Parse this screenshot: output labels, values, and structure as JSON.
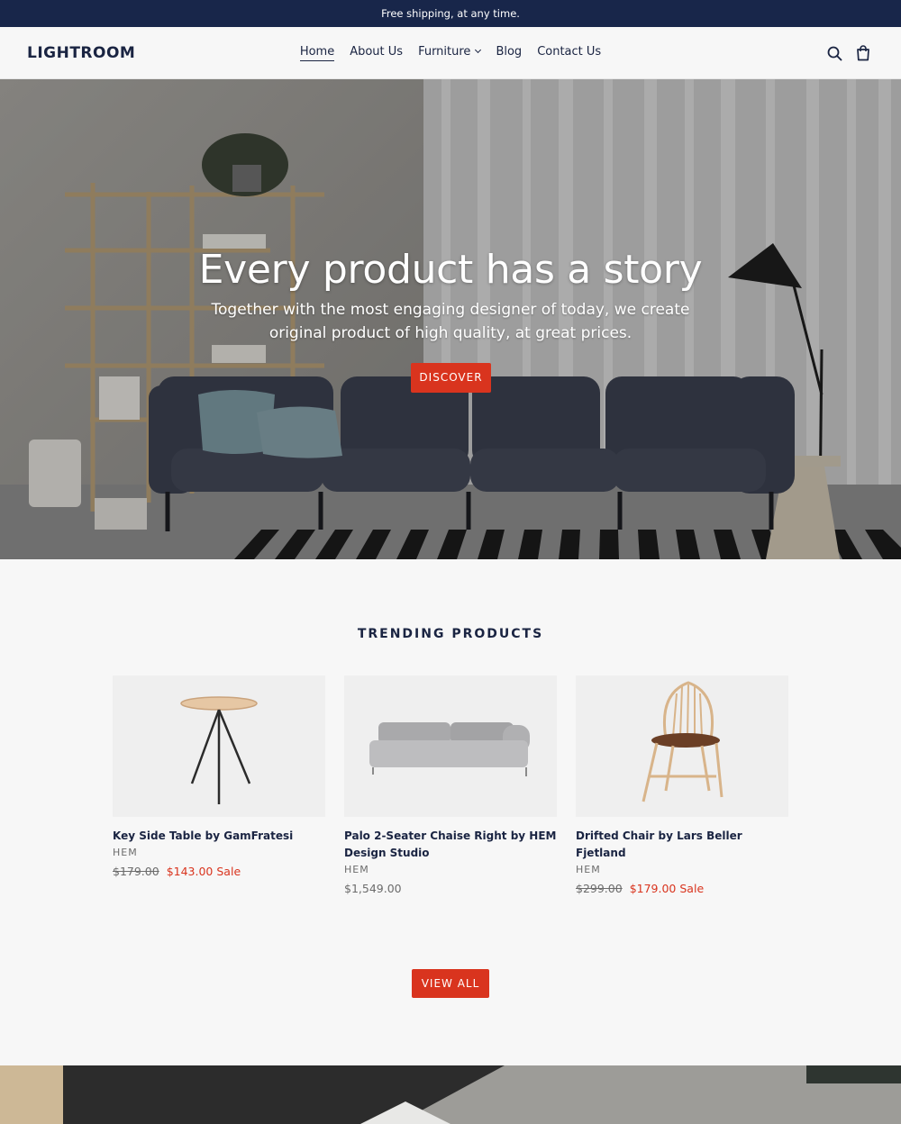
{
  "announcement": {
    "text": "Free shipping, at any time."
  },
  "header": {
    "logo": "LIGHTROOM",
    "nav": [
      {
        "label": "Home",
        "active": true
      },
      {
        "label": "About Us"
      },
      {
        "label": "Furniture",
        "dropdown": true
      },
      {
        "label": "Blog"
      },
      {
        "label": "Contact Us"
      }
    ],
    "icons": [
      "search-icon",
      "cart-icon"
    ]
  },
  "hero": {
    "title": "Every product has a story",
    "subtitle": "Together with the most engaging designer of today, we create original product of high quality, at great prices.",
    "button": "DISCOVER"
  },
  "trending": {
    "title": "TRENDING PRODUCTS",
    "products": [
      {
        "name": "Key Side Table by GamFratesi",
        "vendor": "HEM",
        "original_price": "$179.00",
        "price": "$143.00",
        "sale_label": "Sale"
      },
      {
        "name": "Palo 2-Seater Chaise Right by HEM Design Studio",
        "vendor": "HEM",
        "price": "$1,549.00"
      },
      {
        "name": "Drifted Chair by Lars Beller Fjetland",
        "vendor": "HEM",
        "original_price": "$299.00",
        "price": "$179.00",
        "sale_label": "Sale"
      }
    ],
    "view_all": "VIEW ALL"
  },
  "colors": {
    "navy": "#18264a",
    "accent_red": "#d9341e",
    "background": "#f7f7f7"
  }
}
